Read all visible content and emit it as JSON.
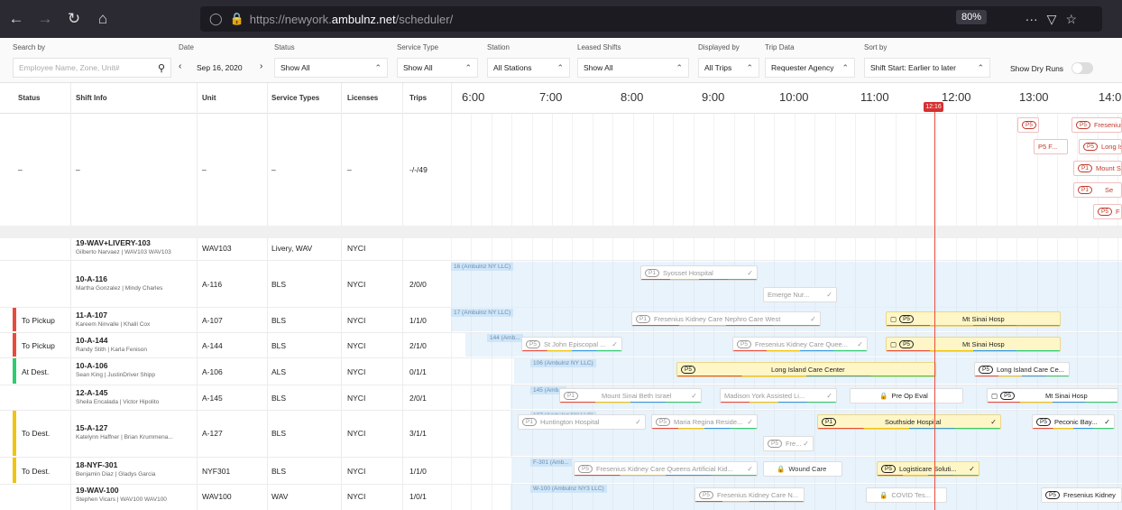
{
  "browser": {
    "url_prefix": "https://newyork.",
    "url_host": "ambulnz.net",
    "url_path": "/scheduler/",
    "zoom": "80%",
    "menu_dots": "···"
  },
  "filters": {
    "search": {
      "label": "Search by",
      "placeholder": "Employee Name, Zone, Unit#"
    },
    "date": {
      "label": "Date",
      "value": "Sep 16, 2020"
    },
    "status": {
      "label": "Status",
      "value": "Show All"
    },
    "service_type": {
      "label": "Service Type",
      "value": "Show All"
    },
    "station": {
      "label": "Station",
      "value": "All Stations"
    },
    "leased_shifts": {
      "label": "Leased Shifts",
      "value": "Show All"
    },
    "displayed_by": {
      "label": "Displayed by",
      "value": "All Trips"
    },
    "trip_data": {
      "label": "Trip Data",
      "value": "Requester Agency"
    },
    "sort_by": {
      "label": "Sort by",
      "value": "Shift Start: Earlier to later"
    },
    "dry_runs": {
      "label": "Show Dry Runs"
    }
  },
  "columns": [
    "Status",
    "Shift Info",
    "Unit",
    "Service Types",
    "Licenses",
    "Trips"
  ],
  "hours": [
    "6:00",
    "7:00",
    "8:00",
    "9:00",
    "10:00",
    "11:00",
    "12:00",
    "13:00",
    "14:0"
  ],
  "now_marker": "12:16",
  "unassigned": {
    "status": "–",
    "shift": "–",
    "unit": "–",
    "service": "–",
    "license": "–",
    "trips": "-/-/49"
  },
  "rows": [
    {
      "status": "",
      "name": "19-WAV+LIVERY-103",
      "crew": "Gilberto Narvaez | WAV103 WAV103",
      "unit": "WAV103",
      "service": "Livery, WAV",
      "license": "NYCI",
      "trips": ""
    },
    {
      "status": "",
      "name": "10-A-116",
      "crew": "Martha Gonzalez | Mindy Charles",
      "unit": "A-116",
      "service": "BLS",
      "license": "NYCI",
      "trips": "2/0/0"
    },
    {
      "status": "To Pickup",
      "name": "11-A-107",
      "crew": "Kareem Ninvalle | Khalil Cox",
      "unit": "A-107",
      "service": "BLS",
      "license": "NYCI",
      "trips": "1/1/0"
    },
    {
      "status": "To Pickup",
      "name": "10-A-144",
      "crew": "Randy Stith | Karla Fenison",
      "unit": "A-144",
      "service": "BLS",
      "license": "NYCI",
      "trips": "2/1/0"
    },
    {
      "status": "At Dest.",
      "name": "10-A-106",
      "crew": "Sean King | JustinDriver Shipp",
      "unit": "A-106",
      "service": "ALS",
      "license": "NYCI",
      "trips": "0/1/1"
    },
    {
      "status": "",
      "name": "12-A-145",
      "crew": "Sheila Encalada | Victor Hipolito",
      "unit": "A-145",
      "service": "BLS",
      "license": "NYCI",
      "trips": "2/0/1"
    },
    {
      "status": "To Dest.",
      "name": "15-A-127",
      "crew": "Katelynn Haffner | Brian Krummena...",
      "unit": "A-127",
      "service": "BLS",
      "license": "NYCI",
      "trips": "3/1/1"
    },
    {
      "status": "To Dest.",
      "name": "18-NYF-301",
      "crew": "Benjamin Diaz | Gladys Garcia",
      "unit": "NYF301",
      "service": "BLS",
      "license": "NYCI",
      "trips": "1/1/0"
    },
    {
      "status": "",
      "name": "19-WAV-100",
      "crew": "Stephen Vicars | WAV100 WAV100",
      "unit": "WAV100",
      "service": "WAV",
      "license": "NYCI",
      "trips": "1/0/1"
    }
  ],
  "trips": {
    "syosset": "Syosset Hospital",
    "emerge": "Emerge Nur...",
    "fresenius_west": "Fresenius Kidney Care Nephro Care West",
    "mt_sinai_1": "Mt Sinai Hosp",
    "st_john": "St John Episcopal ...",
    "fresenius_quee": "Fresenius Kidney Care Quee...",
    "mt_sinai_2": "Mt Sinai Hosp",
    "long_island": "Long Island Care Center",
    "long_island_2": "Long Island Care Ce...",
    "mount_sinai_beth": "Mount Sinai Beth Israel",
    "madison": "Madison York Assisted Li...",
    "pre_op": "Pre Op Eval",
    "mt_sinai_3": "Mt Sinai Hosp",
    "huntington": "Huntington Hospital",
    "maria_regina": "Maria Regina Reside...",
    "southside": "Southside Hospital",
    "peconic": "Peconic Bay...",
    "fre": "Fre...",
    "fresenius_queens": "Fresenius Kidney Care Queens Artificial Kid...",
    "wound": "Wound Care",
    "logisticare": "Logisticare Soluti...",
    "fresenius_n": "Fresenius Kidney Care N...",
    "covid": "COVID Tes...",
    "fresenius_kidney": "Fresenius Kidney"
  },
  "shift_labels": [
    "16 (Ambulnz NY LLC)",
    "17 (Ambulnz NY LLC)",
    "144 (Amb...",
    "106 (Ambulnz NY LLC)",
    "145 (Amb...",
    "127 (Ambulnz NY LLC)",
    "F-301 (Amb...",
    "W-100 (Ambulnz NY3 LLC)"
  ],
  "badges": {
    "p1": "P1",
    "p5": "P5",
    "p5f": "P5 F...",
    "fresenius_top": "Fresenius",
    "long_is_top": "Long Is",
    "mount_top": "Mount S",
    "se": "Se",
    "f_top": "F"
  },
  "colors": {
    "pickup": "#e74c3c",
    "dest": "#f1c40f",
    "at_dest": "#2ecc71",
    "now": "#d63031"
  }
}
